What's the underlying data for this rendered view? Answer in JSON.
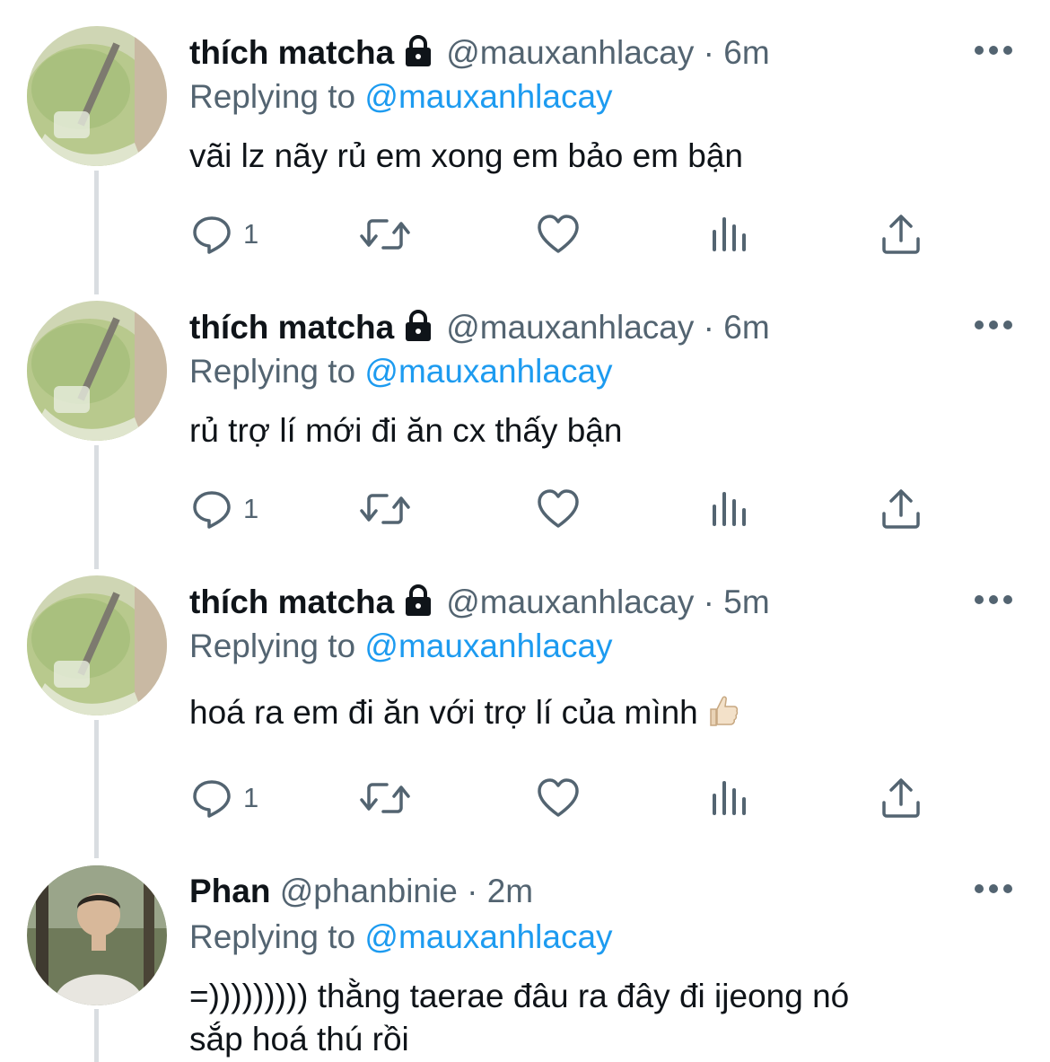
{
  "tweets": [
    {
      "display_name": "thích matcha",
      "handle": "@mauxanhlacay",
      "separator": "·",
      "time": "6m",
      "replying_label": "Replying to",
      "replying_to": "@mauxanhlacay",
      "text": "vãi lz nãy rủ em xong em bảo em bận",
      "reply_count": "1",
      "avatar": "matcha-avatar",
      "locked": true
    },
    {
      "display_name": "thích matcha",
      "handle": "@mauxanhlacay",
      "separator": "·",
      "time": "6m",
      "replying_label": "Replying to",
      "replying_to": "@mauxanhlacay",
      "text": "rủ trợ lí mới đi ăn cx thấy bận",
      "reply_count": "1",
      "avatar": "matcha-avatar",
      "locked": true
    },
    {
      "display_name": "thích matcha",
      "handle": "@mauxanhlacay",
      "separator": "·",
      "time": "5m",
      "replying_label": "Replying to",
      "replying_to": "@mauxanhlacay",
      "text": "hoá ra em đi ăn với trợ lí của mình",
      "emoji": "thumbs-up-light-skin",
      "reply_count": "1",
      "avatar": "matcha-avatar",
      "locked": true
    },
    {
      "display_name": "Phan",
      "handle": "@phanbinie",
      "separator": "·",
      "time": "2m",
      "replying_label": "Replying to",
      "replying_to": "@mauxanhlacay",
      "text_line1": "=))))))))) thằng taerae đâu ra đây đi ijeong nó",
      "text_line2": "sắp hoá thú rồi",
      "avatar": "person-avatar",
      "locked": false
    }
  ],
  "colors": {
    "text": "#0f1419",
    "secondary": "#536471",
    "link": "#1d9bf0",
    "thread_line": "#d9dde1",
    "background": "#ffffff"
  }
}
